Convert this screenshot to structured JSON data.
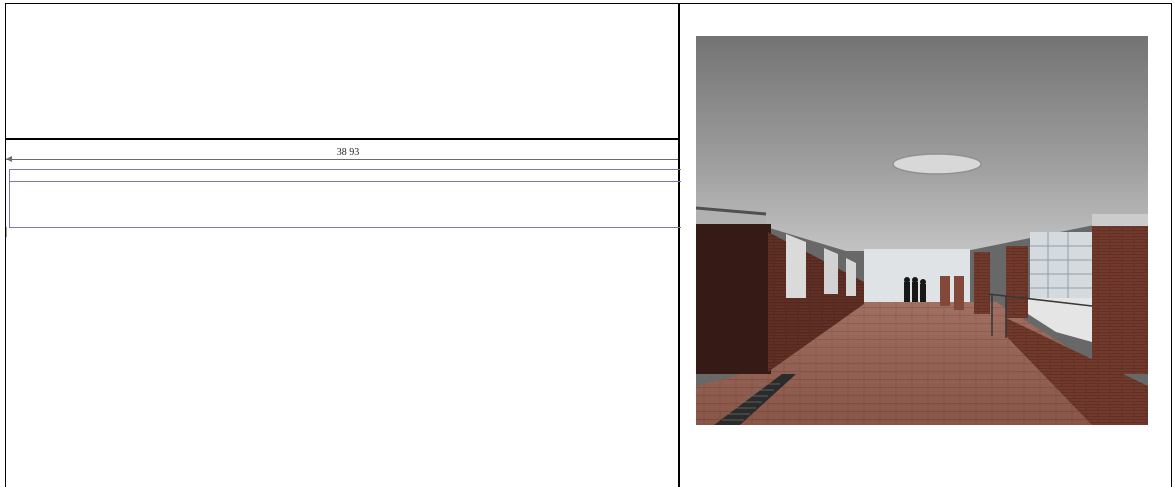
{
  "dimension": {
    "label": "38 93"
  },
  "photo": {
    "icon": "corridor-photo"
  }
}
